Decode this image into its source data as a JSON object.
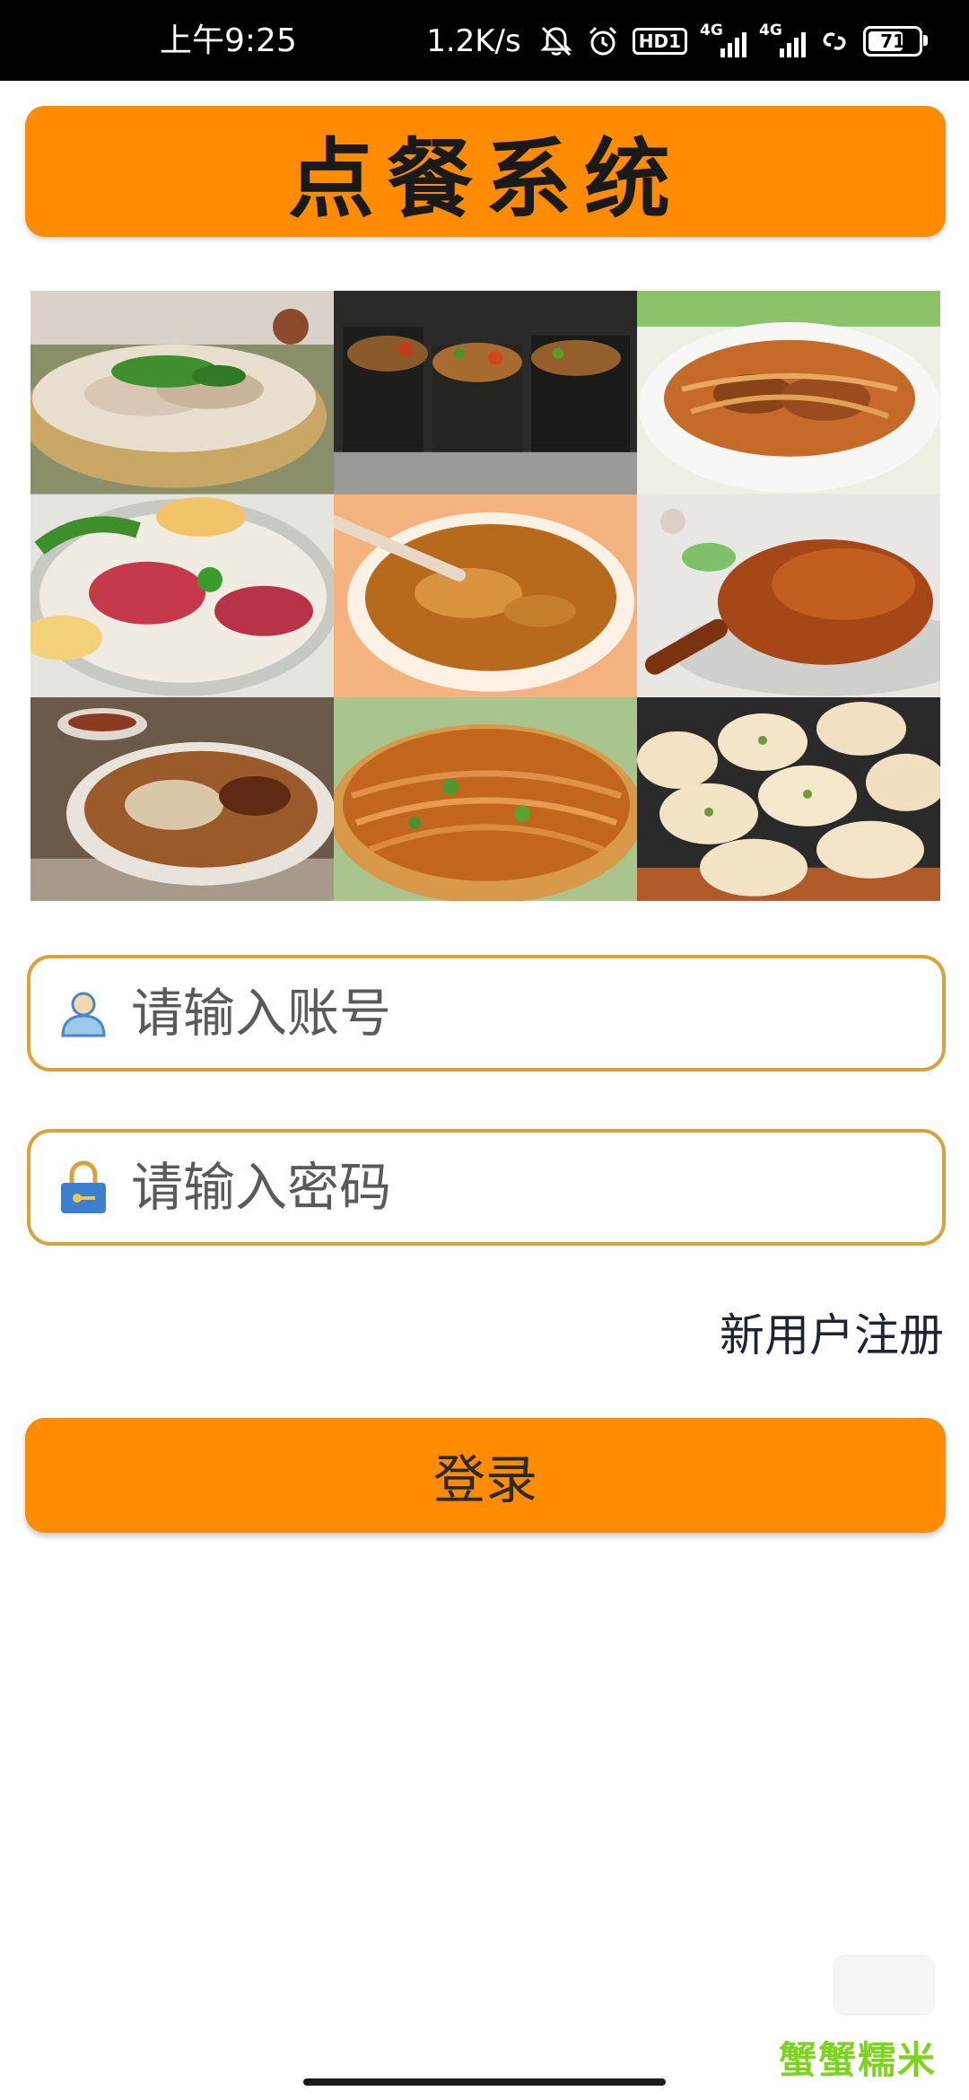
{
  "status_bar": {
    "time": "上午9:25",
    "net_speed": "1.2K/s",
    "hd_label": "HD1",
    "sim1_label": "4G",
    "sim2_label": "4G",
    "battery_level": "71",
    "battery_fraction": 0.71,
    "icons": [
      "mute-bell-icon",
      "alarm-icon",
      "hd-icon",
      "signal-icon",
      "signal-icon",
      "link-icon",
      "battery-icon"
    ]
  },
  "header": {
    "title": "点餐系统"
  },
  "food_images": [
    "noodle-soup-with-greens",
    "grilled-tofu-skewers",
    "braised-noodles-bowl",
    "beef-rice-noodles-with-egg",
    "thick-soup-bowl",
    "roast-duck",
    "hot-dry-noodles-pot",
    "fried-noodles-with-scallion",
    "pan-fried-buns"
  ],
  "form": {
    "account_placeholder": "请输入账号",
    "password_placeholder": "请输入密码",
    "account_icon": "user-icon",
    "password_icon": "lock-icon",
    "register_link": "新用户注册",
    "login_label": "登录"
  },
  "watermark": {
    "text": "蟹蟹糯米"
  },
  "colors": {
    "accent": "#ff8c00",
    "input_border": "#d9a23a",
    "watermark": "#7ed321"
  }
}
